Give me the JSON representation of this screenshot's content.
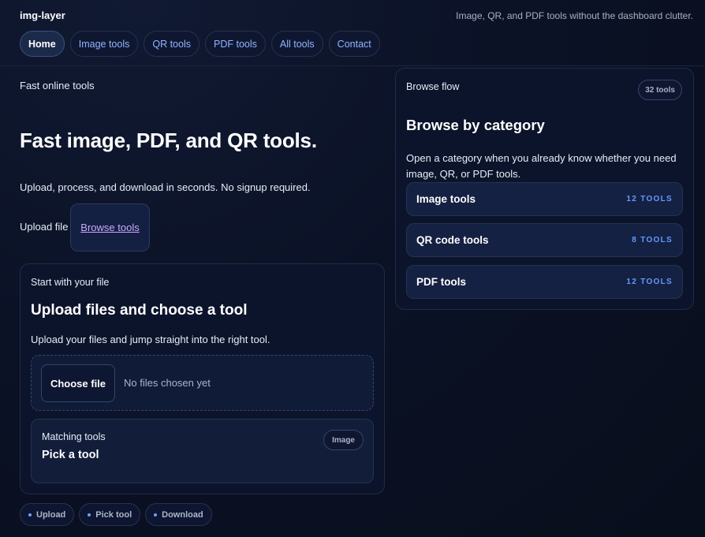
{
  "header": {
    "brand": "img-layer",
    "tagline": "Image, QR, and PDF tools without the dashboard clutter."
  },
  "nav": {
    "items": [
      {
        "label": "Home",
        "active": true
      },
      {
        "label": "Image tools",
        "active": false
      },
      {
        "label": "QR tools",
        "active": false
      },
      {
        "label": "PDF tools",
        "active": false
      },
      {
        "label": "All tools",
        "active": false
      },
      {
        "label": "Contact",
        "active": false
      }
    ]
  },
  "hero": {
    "eyebrow": "Fast online tools",
    "title": "Fast image, PDF, and QR tools.",
    "subtitle": "Upload, process, and download in seconds. No signup required.",
    "upload_label": "Upload file",
    "browse_label": "Browse tools"
  },
  "upload_card": {
    "eyebrow": "Start with your file",
    "title": "Upload files and choose a tool",
    "subtitle": "Upload your files and jump straight into the right tool.",
    "choose_label": "Choose file",
    "no_files": "No files chosen yet",
    "matching": {
      "eyebrow": "Matching tools",
      "title": "Pick a tool",
      "badge": "Image"
    }
  },
  "steps": [
    "Upload",
    "Pick tool",
    "Download"
  ],
  "browse_panel": {
    "eyebrow": "Browse flow",
    "count": "32 tools",
    "title": "Browse by category",
    "description": "Open a category when you already know whether you need image, QR, or PDF tools.",
    "categories": [
      {
        "label": "Image tools",
        "count": "12 tools"
      },
      {
        "label": "QR code tools",
        "count": "8 tools"
      },
      {
        "label": "PDF tools",
        "count": "12 tools"
      }
    ]
  },
  "colors": {
    "background": "#0b1226",
    "accent": "#5f9bff",
    "link": "#c9a8ff",
    "nav_link": "#8fb4ff"
  }
}
